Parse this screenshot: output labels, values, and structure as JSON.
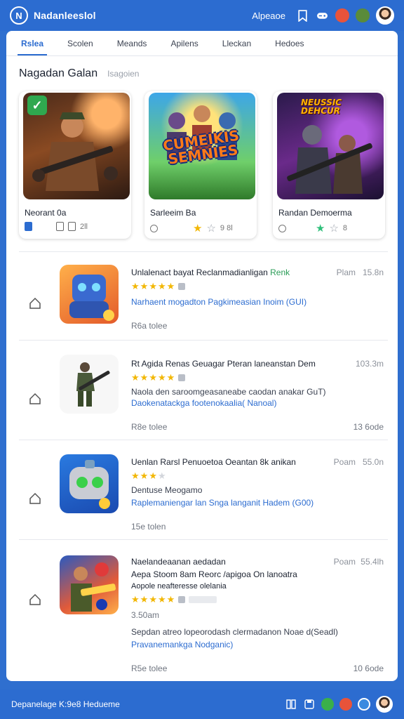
{
  "header": {
    "logo": "N",
    "title": "Nadanleeslol",
    "link": "Alpeaoe"
  },
  "tabs": [
    {
      "label": "Rslea",
      "active": true
    },
    {
      "label": "Scolen",
      "active": false
    },
    {
      "label": "Meands",
      "active": false
    },
    {
      "label": "Apilens",
      "active": false
    },
    {
      "label": "Lleckan",
      "active": false
    },
    {
      "label": "Hedoes",
      "active": false
    }
  ],
  "section": {
    "title": "Nagadan Galan",
    "subtitle": "Isagoien"
  },
  "featured": [
    {
      "name": "Neorant 0a",
      "meta": "2ll",
      "art_text": ""
    },
    {
      "name": "Sarleeim Ba",
      "meta": "9 8l",
      "art_text": "CUMEIKIS SEMNIES"
    },
    {
      "name": "Randan Demoerma",
      "meta": "8",
      "art_text": "NEUSSIC DEHCUR"
    }
  ],
  "list": [
    {
      "title": "Unlalenact bayat Reclanmadianligan",
      "title_hl": "Renk",
      "rank": "Plam",
      "time": "15.8n",
      "rating": 5,
      "desc_lines": [
        "Narhaent mogadton Pagkimeasian Inoim (GUI)"
      ],
      "footer": "R6a tolee",
      "footer_right": ""
    },
    {
      "title": "Rt Agida Renas Geuagar Pteran laneanstan Dem",
      "title_hl": "",
      "rank": "",
      "time": "103.3m",
      "rating": 5,
      "desc_lines": [
        "Naola den saroomgeasaneabe caodan anakar GuT)",
        "Daokenatackga footenokaalia( Nanoal)"
      ],
      "footer": "R8e tolee",
      "footer_right": "13 6ode"
    },
    {
      "title": "Uenlan Rarsl Penuoetoa Oeantan 8k anikan",
      "title_hl": "",
      "rank": "Poam",
      "time": "55.0n",
      "rating": 3,
      "desc_lines": [
        "Dentuse Meogamo",
        "Raplemaniengar lan Snga langanit Hadem (G00)"
      ],
      "footer": "15e tolen",
      "footer_right": ""
    },
    {
      "title": "Naelandeaanan aedadan",
      "subtitle": "Aepa Stoom 8am Reorc /apigoa On lanoatra",
      "subtitle2": "Aopole neafteresse olelania",
      "title_hl": "",
      "rank": "Poam",
      "time": "55.4lh",
      "rating": 5,
      "extra": "3.50am",
      "desc_lines": [
        "Sepdan atreo lopeorodash clermadanon Noae d(Seadl)",
        "Pravanemankga Nodganic)"
      ],
      "footer": "R5e tolee",
      "footer_right": "10 6ode"
    }
  ],
  "footer": {
    "text": "Depanelage K:9e8 Hedueme"
  },
  "colors": {
    "brand": "#2c6cd0",
    "star": "#f2b705",
    "highlight": "#2a9c57"
  }
}
